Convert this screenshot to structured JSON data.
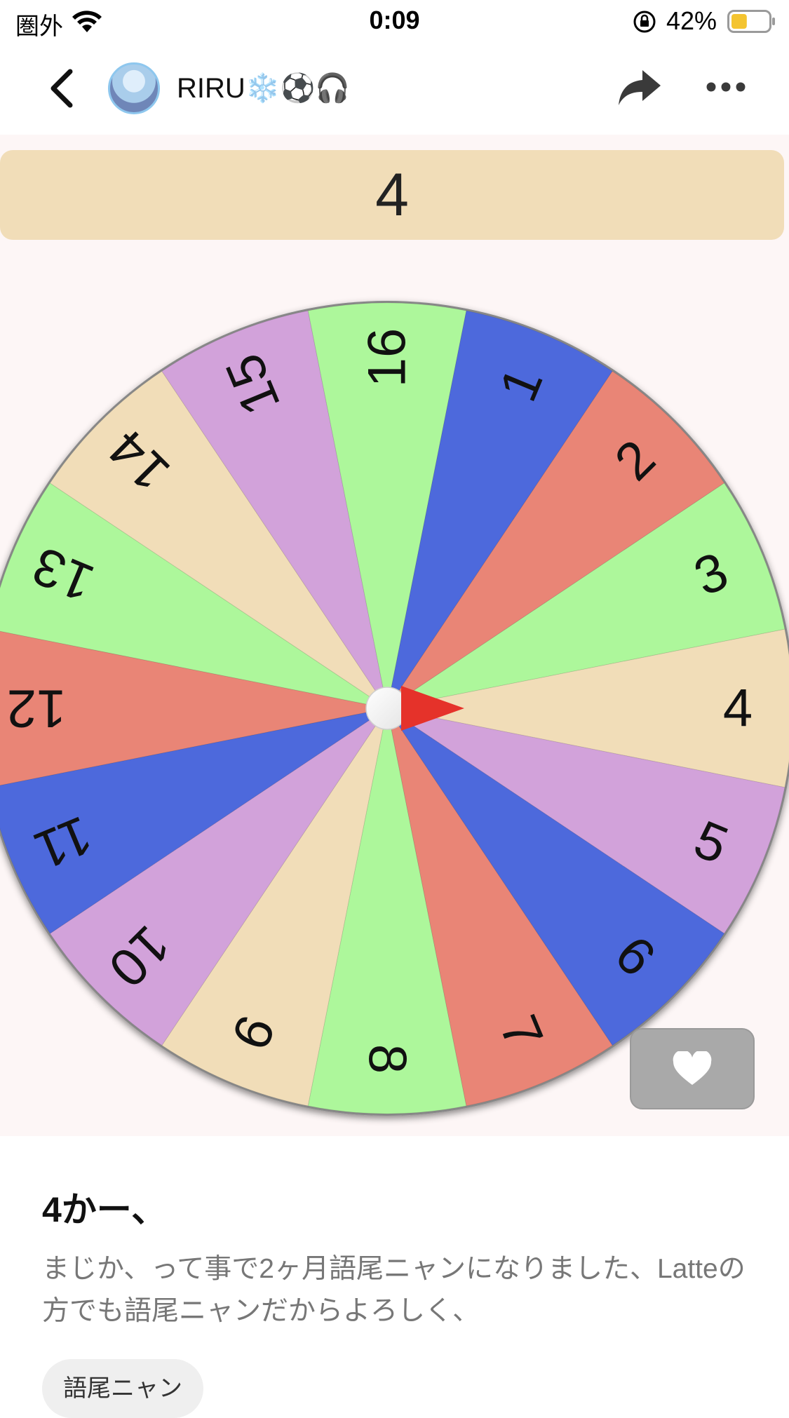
{
  "status_bar": {
    "carrier": "圏外",
    "time": "0:09",
    "battery_percent": "42%",
    "battery_level": 0.42,
    "battery_color": "#f4c430"
  },
  "nav": {
    "username": "RIRU❄️⚽🎧",
    "icons": [
      "chevron-left-icon",
      "avatar",
      "share-icon",
      "more-icon"
    ]
  },
  "spinner": {
    "result": "4",
    "segments": [
      {
        "label": "1",
        "color": "#4d69dc"
      },
      {
        "label": "2",
        "color": "#e98576"
      },
      {
        "label": "3",
        "color": "#adf79b"
      },
      {
        "label": "4",
        "color": "#f1ddb8"
      },
      {
        "label": "5",
        "color": "#d2a2da"
      },
      {
        "label": "6",
        "color": "#4d69dc"
      },
      {
        "label": "7",
        "color": "#e98576"
      },
      {
        "label": "8",
        "color": "#adf79b"
      },
      {
        "label": "9",
        "color": "#f1ddb8"
      },
      {
        "label": "10",
        "color": "#d2a2da"
      },
      {
        "label": "11",
        "color": "#4d69dc"
      },
      {
        "label": "12",
        "color": "#e98576"
      },
      {
        "label": "13",
        "color": "#adf79b"
      },
      {
        "label": "14",
        "color": "#f1ddb8"
      },
      {
        "label": "15",
        "color": "#d2a2da"
      },
      {
        "label": "16",
        "color": "#adf79b"
      }
    ],
    "pointer_color": "#e5322a"
  },
  "post": {
    "title": "4かー、",
    "body": "まじか、って事で2ヶ月語尾ニャンになりました、Latteの方でも語尾ニャンだからよろしく、",
    "tag": "語尾ニャン"
  }
}
